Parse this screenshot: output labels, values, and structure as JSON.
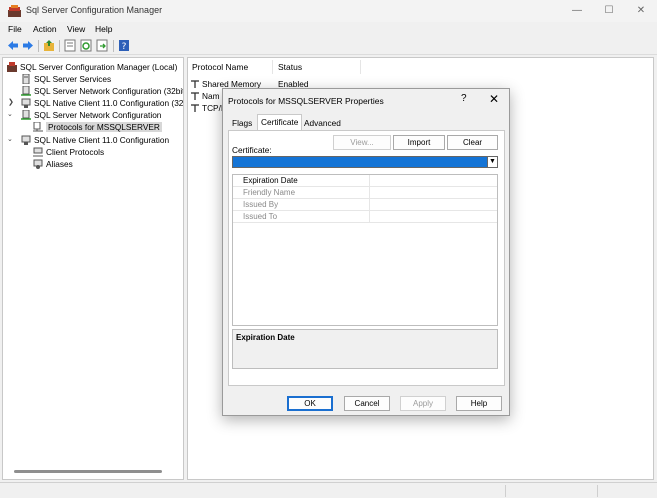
{
  "window": {
    "title": "Sql Server Configuration Manager",
    "controls": {
      "minimize": "—",
      "maximize": "☐",
      "close": "✕"
    }
  },
  "menu": [
    "File",
    "Action",
    "View",
    "Help"
  ],
  "toolbar": [
    "back-icon",
    "forward-icon",
    "up-folder-icon",
    "properties-icon",
    "refresh-icon",
    "export-icon",
    "help-icon"
  ],
  "tree": {
    "root": "SQL Server Configuration Manager (Local)",
    "items": [
      "SQL Server Services",
      "SQL Server Network Configuration (32bit",
      "SQL Native Client 11.0 Configuration (32b",
      "SQL Server Network Configuration",
      "Protocols for MSSQLSERVER",
      "SQL Native Client 11.0 Configuration",
      "Client Protocols",
      "Aliases"
    ]
  },
  "list": {
    "columns": [
      "Protocol Name",
      "Status"
    ],
    "rows": [
      {
        "name": "Shared Memory",
        "status": "Enabled"
      },
      {
        "name": "Nam",
        "status": ""
      },
      {
        "name": "TCP/I",
        "status": ""
      }
    ]
  },
  "dialog": {
    "title": "Protocols for MSSQLSERVER Properties",
    "help": "?",
    "close": "✕",
    "tabs": [
      "Flags",
      "Certificate",
      "Advanced"
    ],
    "active_tab": "Certificate",
    "certificate_label": "Certificate:",
    "buttons": {
      "view": "View...",
      "import": "Import",
      "clear": "Clear"
    },
    "selected_certificate": "",
    "properties": [
      "Expiration Date",
      "Friendly Name",
      "Issued By",
      "Issued To"
    ],
    "description_title": "Expiration Date",
    "footer": {
      "ok": "OK",
      "cancel": "Cancel",
      "apply": "Apply",
      "help": "Help"
    }
  },
  "colors": {
    "selection": "#1474d6",
    "default_button_border": "#1a6fd0"
  }
}
